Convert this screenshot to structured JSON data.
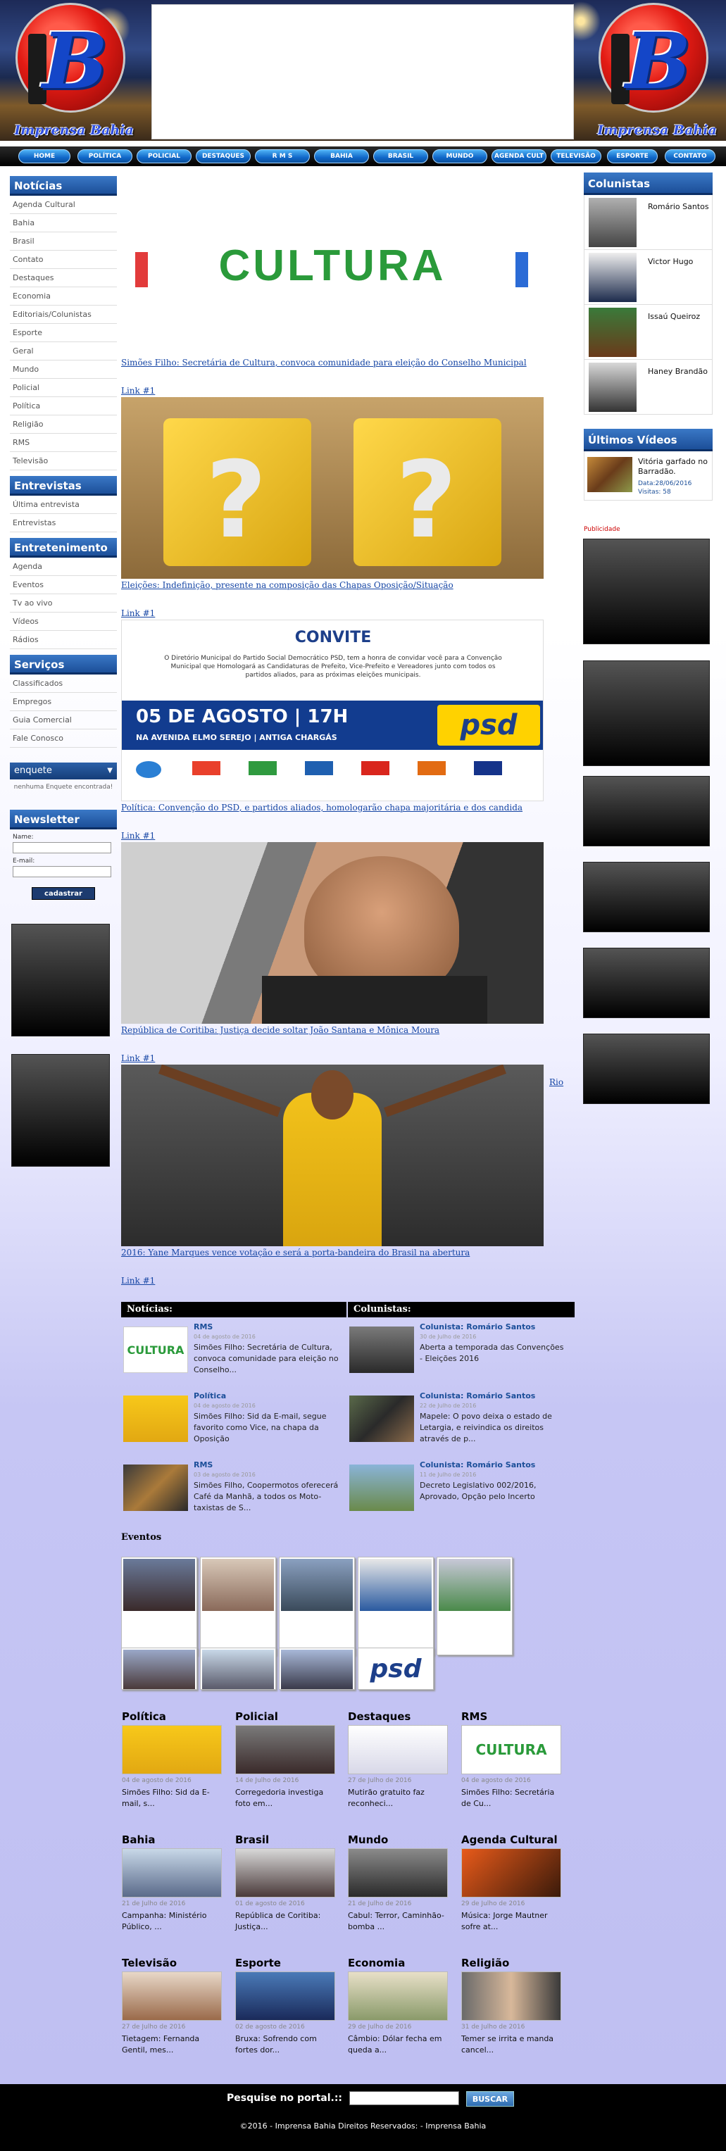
{
  "header": {
    "brand_left": "Imprensa Bahia",
    "brand_right": "Imprensa Bahia",
    "logo_letter": "B"
  },
  "nav": [
    "HOME",
    "POLÍTICA",
    "POLICIAL",
    "DESTAQUES",
    "R M S",
    "BAHIA",
    "BRASIL",
    "MUNDO",
    "AGENDA CULT",
    "TELEVISÃO",
    "ESPORTE",
    "CONTATO"
  ],
  "sidebar": {
    "noticias_title": "Notícias",
    "noticias": [
      "Agenda Cultural",
      "Bahia",
      "Brasil",
      "Contato",
      "Destaques",
      "Economia",
      "Editoriais/Colunistas",
      "Esporte",
      "Geral",
      "Mundo",
      "Policial",
      "Política",
      "Religião",
      "RMS",
      "Televisão"
    ],
    "entrevistas_title": "Entrevistas",
    "entrevistas": [
      "Última entrevista",
      "Entrevistas"
    ],
    "entretenimento_title": "Entretenimento",
    "entretenimento": [
      "Agenda",
      "Eventos",
      "Tv ao vivo",
      "Vídeos",
      "Rádios"
    ],
    "servicos_title": "Serviços",
    "servicos": [
      "Classificados",
      "Empregos",
      "Guia Comercial",
      "Fale Conosco"
    ],
    "enquete_label": "enquete",
    "enquete_msg": "nenhuma Enquete encontrada!",
    "newsletter_title": "Newsletter",
    "name_label": "Name:",
    "email_label": "E-mail:",
    "cadastrar": "cadastrar"
  },
  "featured": [
    {
      "img": "CULTURA",
      "link": "Simões Filho: Secretária de Cultura, convoca comunidade para eleição do Conselho Municipal",
      "more": "Link #1"
    },
    {
      "img": "?",
      "link": "Eleições: Indefinição, presente na composição das Chapas Oposição/Situação",
      "more": "Link #1"
    },
    {
      "img": "CONVITE",
      "link": "Política: Convenção do PSD, e partidos aliados, homologarão chapa majoritária e dos candida",
      "more": "Link #1"
    },
    {
      "img": "",
      "link": "República de Coritiba: Justiça decide soltar João Santana e Mônica Moura",
      "more": "Link #1"
    },
    {
      "img": "",
      "link": "2016: Yane Marques vence votação e será a porta-bandeira do Brasil na abertura",
      "more": "Link #1"
    }
  ],
  "rio_link": "Rio",
  "convite": {
    "title": "CONVITE",
    "text": "O Diretório Municipal do Partido Social Democrático PSD, tem a honra de convidar você para a Convenção Municipal que Homologará as Candidaturas de Prefeito, Vice-Prefeito e Vereadores junto com todos os partidos aliados, para as próximas eleições municipais.",
    "date": "05 DE AGOSTO | 17H",
    "place": "NA AVENIDA ELMO SEREJO | ANTIGA CHARGÁS",
    "party": "psd"
  },
  "right": {
    "colunistas_title": "Colunistas",
    "colunistas": [
      "Romário Santos",
      "Victor Hugo",
      "Issaú Queiroz",
      "Haney Brandão"
    ],
    "videos_title": "Últimos Vídeos",
    "video_title": "Vitória garfado no Barradão.",
    "video_date": "Data:28/06/2016",
    "video_views": "Visitas: 58",
    "publicidade": "Publicidade"
  },
  "news_box": {
    "noticias_label": "Notícias:",
    "colunistas_label": "Colunistas:",
    "noticias": [
      {
        "cat": "RMS",
        "date": "04 de agosto de 2016",
        "title": "Simões Filho: Secretária de Cultura, convoca comunidade para eleição no Conselho..."
      },
      {
        "cat": "Política",
        "date": "04 de agosto de 2016",
        "title": "Simões Filho: Sid da E-mail, segue favorito como Vice, na chapa da Oposição"
      },
      {
        "cat": "RMS",
        "date": "03 de agosto de 2016",
        "title": "Simões Filho, Coopermotos oferecerá Café da Manhã, a todos os Moto-taxistas de S..."
      }
    ],
    "colunistas": [
      {
        "cat": "Colunista: Romário Santos",
        "date": "30 de Julho de 2016",
        "title": "Aberta a temporada das Convenções - Eleições 2016"
      },
      {
        "cat": "Colunista: Romário Santos",
        "date": "22 de Julho de 2016",
        "title": "Mapele: O povo deixa o estado de Letargia, e reivindica os direitos através de p..."
      },
      {
        "cat": "Colunista: Romário Santos",
        "date": "11 de Julho de 2016",
        "title": "Decreto Legislativo 002/2016, Aprovado, Opção pelo Incerto"
      }
    ]
  },
  "eventos_title": "Eventos",
  "categories": [
    {
      "name": "Política",
      "date": "04 de agosto de 2016",
      "title": "Simões Filho: Sid da E-mail, s..."
    },
    {
      "name": "Policial",
      "date": "14 de Julho de 2016",
      "title": "Corregedoria investiga foto em..."
    },
    {
      "name": "Destaques",
      "date": "27 de Julho de 2016",
      "title": "Mutirão gratuito faz reconheci..."
    },
    {
      "name": "RMS",
      "date": "04 de agosto de 2016",
      "title": "Simões Filho: Secretária de Cu..."
    },
    {
      "name": "Bahia",
      "date": "21 de Julho de 2016",
      "title": "Campanha: Ministério Público, ..."
    },
    {
      "name": "Brasil",
      "date": "01 de agosto de 2016",
      "title": "República de Coritiba: Justiça..."
    },
    {
      "name": "Mundo",
      "date": "21 de Julho de 2016",
      "title": "Cabul: Terror, Caminhão-bomba ..."
    },
    {
      "name": "Agenda Cultural",
      "date": "29 de Julho de 2016",
      "title": "Música: Jorge Mautner sofre at..."
    },
    {
      "name": "Televisão",
      "date": "27 de Julho de 2016",
      "title": "Tietagem: Fernanda Gentil, mes..."
    },
    {
      "name": "Esporte",
      "date": "02 de agosto de 2016",
      "title": "Bruxa: Sofrendo com fortes dor..."
    },
    {
      "name": "Economia",
      "date": "29 de Julho de 2016",
      "title": "Câmbio: Dólar fecha em queda a..."
    },
    {
      "name": "Religião",
      "date": "31 de Julho de 2016",
      "title": "Temer se irrita e manda cancel..."
    }
  ],
  "footer": {
    "search_label": "Pesquise no portal.::",
    "search_button": "BUSCAR",
    "copyright": "©2016 - Imprensa Bahia Direitos Reservados: - Imprensa Bahia"
  }
}
